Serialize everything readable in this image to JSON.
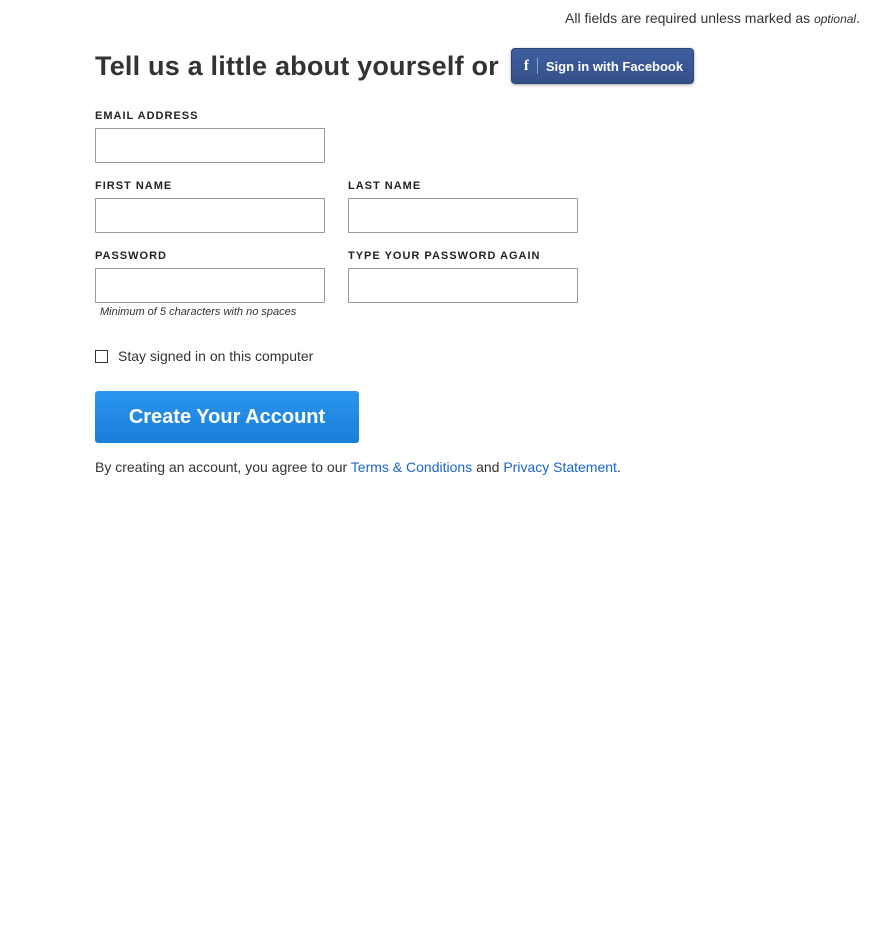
{
  "notice": {
    "text": "All fields are required unless marked as ",
    "optional_word": "optional",
    "end": "."
  },
  "header": {
    "title": "Tell us a little about yourself or",
    "facebook_icon": "f",
    "facebook_button": "Sign in with Facebook"
  },
  "form": {
    "email": {
      "label": "EMAIL ADDRESS",
      "value": ""
    },
    "first_name": {
      "label": "FIRST NAME",
      "value": ""
    },
    "last_name": {
      "label": "LAST NAME",
      "value": ""
    },
    "password": {
      "label": "PASSWORD",
      "value": "",
      "hint": "Minimum of 5 characters with no spaces"
    },
    "password_again": {
      "label": "TYPE YOUR PASSWORD AGAIN",
      "value": ""
    },
    "stay_signed_in": {
      "label": "Stay signed in on this computer",
      "checked": false
    },
    "submit": "Create Your Account"
  },
  "agreement": {
    "prefix": "By creating an account, you agree to our ",
    "terms_link": "Terms & Conditions",
    "middle": " and ",
    "privacy_link": "Privacy Statement",
    "suffix": "."
  },
  "colors": {
    "facebook_blue": "#3b5998",
    "primary_button": "#1e88e5",
    "link": "#1a66c9"
  },
  "icons": {
    "facebook": "facebook-icon",
    "checkbox": "checkbox-icon"
  }
}
